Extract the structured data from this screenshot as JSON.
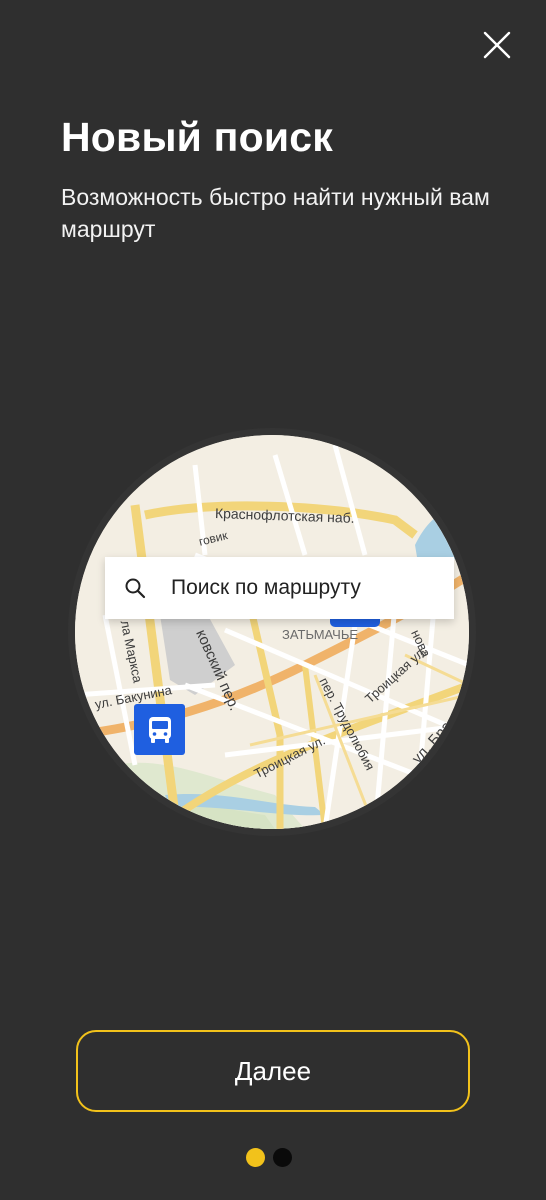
{
  "header": {
    "close_icon": "close-icon",
    "title": "Новый поиск",
    "subtitle": "Возможность быстро найти нужный вам маршрут"
  },
  "illustration": {
    "search_placeholder": "Поиск по маршруту",
    "search_icon": "search-icon",
    "bus_stop_icon": "bus-icon",
    "map_labels": {
      "krasnoflotskaya": "Краснофлотская наб.",
      "lenin_fragment": "говик",
      "zatmache": "ЗАТЬМАЧЬЕ",
      "marksa": "ла Маркса",
      "kovsky": "ковский пер.",
      "bakunina": "ул. Бакунина",
      "trudolyubia": "пер. Трудолюбия",
      "troitskaya_1": "Троицкая ул.",
      "troitskaya_2": "Троицкая ул.",
      "troitskaya_3": "Троицкая ул.",
      "bra": "ул. Бра",
      "nova": "нова"
    }
  },
  "footer": {
    "next_label": "Далее",
    "pager": {
      "total": 2,
      "active": 1
    }
  },
  "colors": {
    "background": "#2f2f2f",
    "accent": "#f2c21b",
    "inactive_dot": "#0a0a0a",
    "bus_stop": "#1f5fe0"
  }
}
